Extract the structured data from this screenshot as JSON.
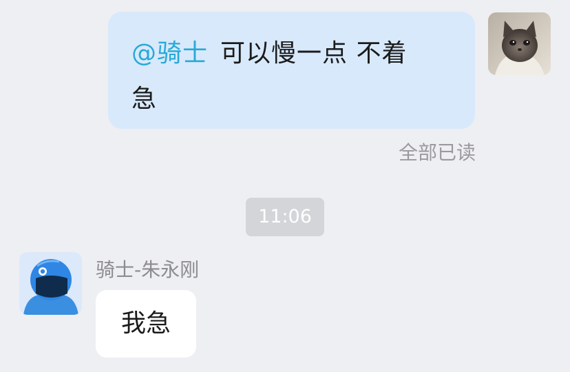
{
  "sent_message": {
    "mention": "@骑士",
    "text_line1": "可以慢一点 不着",
    "text_line2": "急",
    "read_status": "全部已读",
    "avatar_icon": "cat-avatar-icon"
  },
  "divider": {
    "time": "11:06"
  },
  "received_message": {
    "sender_name": "骑士-朱永刚",
    "text": "我急",
    "avatar_icon": "rider-helmet-avatar-icon"
  },
  "colors": {
    "background": "#eeeff3",
    "sent_bubble": "#d8e9fb",
    "received_bubble": "#ffffff",
    "mention": "#27a9d8",
    "time_chip": "#d4d5d9"
  }
}
